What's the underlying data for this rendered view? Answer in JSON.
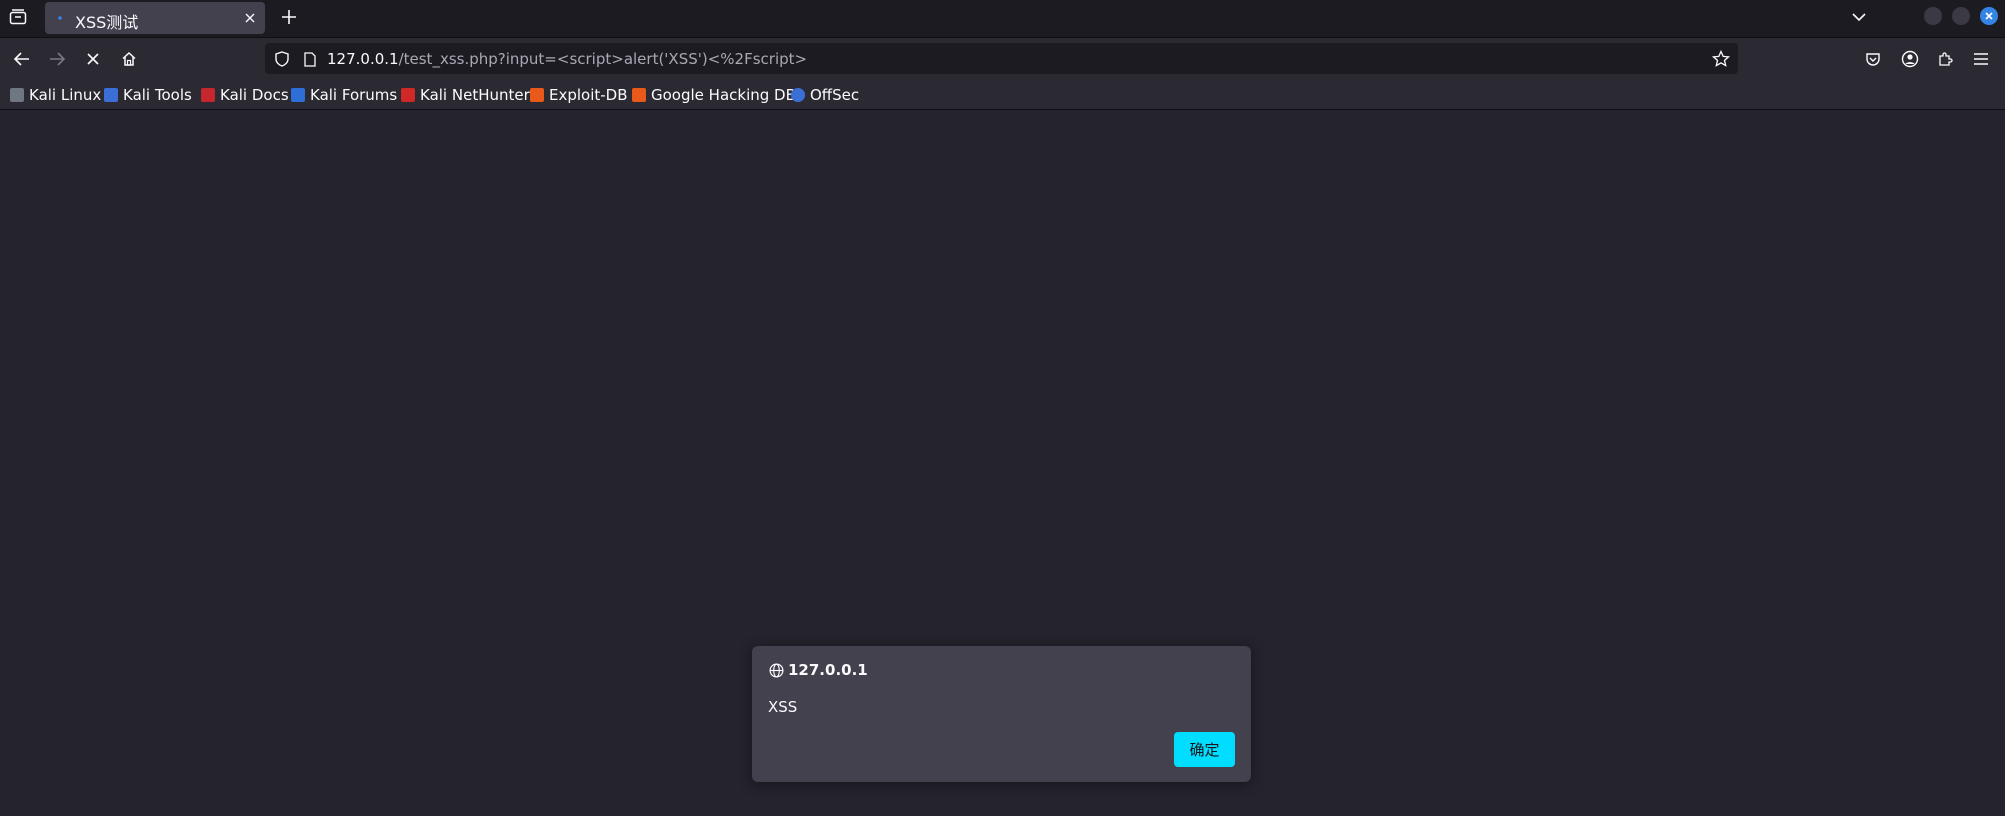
{
  "tab": {
    "title": "XSS测试"
  },
  "address": {
    "host": "127.0.0.1",
    "path": "/test_xss.php?input=<script>alert('XSS')<%2Fscript>"
  },
  "bookmarks": [
    {
      "label": "Kali Linux",
      "icon": "kali-dragon-icon",
      "color": "#6f7782"
    },
    {
      "label": "Kali Tools",
      "icon": "kali-tools-icon",
      "color": "#3b6fd6"
    },
    {
      "label": "Kali Docs",
      "icon": "kali-docs-icon",
      "color": "#c6262e"
    },
    {
      "label": "Kali Forums",
      "icon": "kali-forums-icon",
      "color": "#2d6fd6"
    },
    {
      "label": "Kali NetHunter",
      "icon": "nethunter-icon",
      "color": "#d02727"
    },
    {
      "label": "Exploit-DB",
      "icon": "exploit-db-icon",
      "color": "#e8591a"
    },
    {
      "label": "Google Hacking DB",
      "icon": "ghdb-icon",
      "color": "#e8591a"
    },
    {
      "label": "OffSec",
      "icon": "offsec-icon",
      "color": "#3b6fd6"
    }
  ],
  "dialog": {
    "origin": "127.0.0.1",
    "message": "XSS",
    "ok_label": "确定"
  },
  "colors": {
    "accent": "#00ddff",
    "window_close": "#3584e4"
  }
}
